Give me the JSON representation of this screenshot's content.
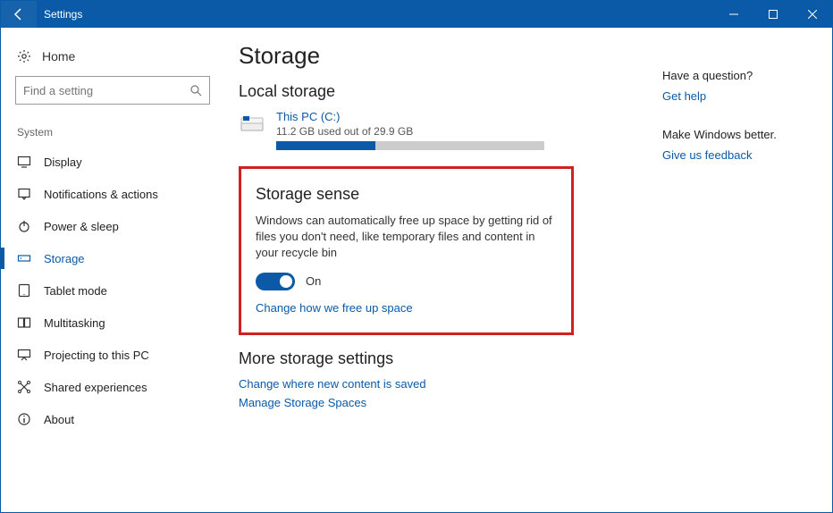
{
  "titlebar": {
    "title": "Settings"
  },
  "sidebar": {
    "home": "Home",
    "search_placeholder": "Find a setting",
    "group_label": "System",
    "items": [
      {
        "label": "Display"
      },
      {
        "label": "Notifications & actions"
      },
      {
        "label": "Power & sleep"
      },
      {
        "label": "Storage"
      },
      {
        "label": "Tablet mode"
      },
      {
        "label": "Multitasking"
      },
      {
        "label": "Projecting to this PC"
      },
      {
        "label": "Shared experiences"
      },
      {
        "label": "About"
      }
    ]
  },
  "main": {
    "page_title": "Storage",
    "local_storage_heading": "Local storage",
    "drive": {
      "name": "This PC (C:)",
      "usage_text": "11.2 GB used out of 29.9 GB",
      "used_gb": 11.2,
      "total_gb": 29.9,
      "fill_percent": 37
    },
    "storage_sense": {
      "heading": "Storage sense",
      "description": "Windows can automatically free up space by getting rid of files you don't need, like temporary files and content in your recycle bin",
      "toggle_state": "On",
      "change_link": "Change how we free up space"
    },
    "more_settings": {
      "heading": "More storage settings",
      "links": [
        "Change where new content is saved",
        "Manage Storage Spaces"
      ]
    }
  },
  "right": {
    "question_heading": "Have a question?",
    "get_help": "Get help",
    "feedback_heading": "Make Windows better.",
    "give_feedback": "Give us feedback"
  }
}
